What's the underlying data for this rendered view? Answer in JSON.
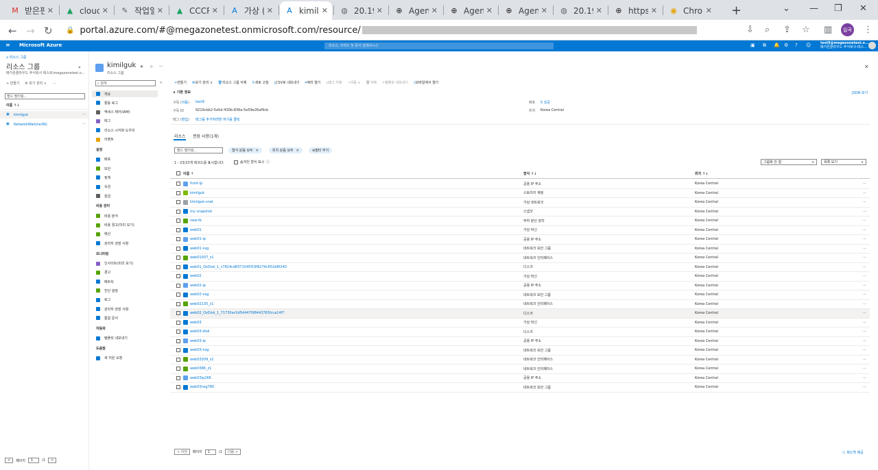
{
  "browser": {
    "tabs": [
      {
        "label": "받은편",
        "icon": "gmail-icon",
        "glyph": "M",
        "color": "#d93025"
      },
      {
        "label": "cloud",
        "icon": "drive-icon",
        "glyph": "▲",
        "color": "#1fa463"
      },
      {
        "label": "작업일",
        "icon": "edit-icon",
        "glyph": "✎",
        "color": "#5f6368"
      },
      {
        "label": "CCCR",
        "icon": "drive-icon",
        "glyph": "▲",
        "color": "#1fa463"
      },
      {
        "label": "가상 (",
        "icon": "azure-icon",
        "glyph": "A",
        "color": "#0078d4"
      },
      {
        "label": "kimilg",
        "icon": "azure-icon",
        "glyph": "A",
        "color": "#0078d4",
        "active": true
      },
      {
        "label": "20.19(",
        "icon": "globe-icon",
        "glyph": "◍",
        "color": "#5f6368"
      },
      {
        "label": "Agenc",
        "icon": "globe-icon",
        "glyph": "⊕",
        "color": "#202124"
      },
      {
        "label": "Agenc",
        "icon": "globe-icon",
        "glyph": "⊕",
        "color": "#202124"
      },
      {
        "label": "Agenc",
        "icon": "globe-icon",
        "glyph": "⊕",
        "color": "#202124"
      },
      {
        "label": "20.19(",
        "icon": "globe-icon",
        "glyph": "◍",
        "color": "#5f6368"
      },
      {
        "label": "https:/",
        "icon": "globe-icon",
        "glyph": "⊕",
        "color": "#202124"
      },
      {
        "label": "Chron",
        "icon": "chrome-icon",
        "glyph": "◉",
        "color": "#e8a200"
      }
    ],
    "url": "portal.azure.com/#@megazonetest.onmicrosoft.com/resource/",
    "profile": "일곡"
  },
  "portal": {
    "brand": "Microsoft Azure",
    "search_placeholder": "리소스, 서비스 및 문서 검색(G+/)",
    "user_email": "test9@megazonetest.o...",
    "user_org": "메가존클라우드 주식회사-테스..."
  },
  "left": {
    "breadcrumb": "리소스 그룹",
    "title": "리소스 그룹",
    "subtitle": "메가존클라우드 주식회사 테스트(megazonetest.o...",
    "create": "+ 만들기",
    "manage_view": "보기 관리 ∨",
    "more": "···",
    "filter_placeholder": "필드 필터링...",
    "col_name": "이름 ↑↓",
    "items": [
      "kimilguk",
      "NetworkWatcherRG"
    ],
    "page_prev": "<",
    "page_label": "페이지",
    "page_value": "1",
    "page_of": "/1",
    "page_next": ">"
  },
  "resource": {
    "name": "kimilguk",
    "type": "리소스 그룹",
    "pin": "✭",
    "star": "☆",
    "more": "···"
  },
  "menu": {
    "search_placeholder": "검색",
    "collapse": "«",
    "top": [
      {
        "label": "개요",
        "icon": "overview-icon",
        "color": "#0078d4"
      },
      {
        "label": "활동 로그",
        "icon": "activity-log-icon",
        "color": "#0078d4"
      },
      {
        "label": "액세스 제어(IAM)",
        "icon": "iam-icon",
        "color": "#605e5c"
      },
      {
        "label": "태그",
        "icon": "tag-icon",
        "color": "#8661c5"
      },
      {
        "label": "리소스 시각화 도우미",
        "icon": "visualizer-icon",
        "color": "#0078d4"
      },
      {
        "label": "이벤트",
        "icon": "event-icon",
        "color": "#e8a200"
      }
    ],
    "sections": [
      {
        "title": "설정",
        "items": [
          {
            "label": "배포",
            "icon": "deploy-icon",
            "color": "#0078d4"
          },
          {
            "label": "보안",
            "icon": "security-icon",
            "color": "#57a300"
          },
          {
            "label": "정책",
            "icon": "policy-icon",
            "color": "#0078d4"
          },
          {
            "label": "속성",
            "icon": "properties-icon",
            "color": "#0078d4"
          },
          {
            "label": "잠금",
            "icon": "lock-icon",
            "color": "#605e5c"
          }
        ]
      },
      {
        "title": "비용 관리",
        "items": [
          {
            "label": "비용 분석",
            "icon": "cost-analysis-icon",
            "color": "#57a300"
          },
          {
            "label": "비용 경고(미리 보기)",
            "icon": "cost-alert-icon",
            "color": "#57a300"
          },
          {
            "label": "예산",
            "icon": "budget-icon",
            "color": "#57a300"
          },
          {
            "label": "관리자 권장 사항",
            "icon": "advisor-icon",
            "color": "#0078d4"
          }
        ]
      },
      {
        "title": "모니터링",
        "items": [
          {
            "label": "인사이트(미리 보기)",
            "icon": "insights-icon",
            "color": "#8661c5"
          },
          {
            "label": "경고",
            "icon": "alert-icon",
            "color": "#57a300"
          },
          {
            "label": "메트릭",
            "icon": "metrics-icon",
            "color": "#0078d4"
          },
          {
            "label": "진단 설정",
            "icon": "diagnostic-icon",
            "color": "#57a300"
          },
          {
            "label": "로그",
            "icon": "logs-icon",
            "color": "#0078d4"
          },
          {
            "label": "관리자 권장 사항",
            "icon": "advisor-icon",
            "color": "#0078d4"
          },
          {
            "label": "통합 문서",
            "icon": "workbook-icon",
            "color": "#0078d4"
          }
        ]
      },
      {
        "title": "자동화",
        "items": [
          {
            "label": "템플릿 내보내기",
            "icon": "export-template-icon",
            "color": "#0078d4"
          }
        ]
      },
      {
        "title": "도움말",
        "items": [
          {
            "label": "새 지원 요청",
            "icon": "support-icon",
            "color": "#0078d4"
          }
        ]
      }
    ]
  },
  "toolbar": [
    {
      "label": "만들기",
      "icon": "plus-icon"
    },
    {
      "label": "보기 관리 ∨",
      "icon": "gear-icon"
    },
    {
      "label": "리소스 그룹 삭제",
      "icon": "trash-icon"
    },
    {
      "label": "새로 고침",
      "icon": "refresh-icon"
    },
    {
      "label": "CSV로 내보내기",
      "icon": "download-icon"
    },
    {
      "label": "쿼리 열기",
      "icon": "query-icon"
    },
    {
      "label": "태그 지정",
      "icon": "tag-icon",
      "disabled": true
    },
    {
      "label": "이동 ∨",
      "icon": "move-icon",
      "disabled": true
    },
    {
      "label": "삭제",
      "icon": "trash-icon",
      "disabled": true
    },
    {
      "label": "템플릿 내보내기",
      "icon": "export-icon",
      "disabled": true
    },
    {
      "label": "모바일에서 열기",
      "icon": "mobile-icon"
    }
  ],
  "essentials": {
    "header": "기본 정보",
    "json_view": "JSON 보기",
    "subscription_label": "구독 (",
    "subscription_move": "이동",
    "subscription_close": ")",
    "subscription_value": "test9",
    "subscription_id_label": "구독 ID",
    "subscription_id_value": "9219cbb2-5a5d-430b-836a-5e59e26af9cb",
    "tags_label": "태그 (",
    "tags_edit": "편집",
    "tags_close": ")",
    "tags_value": "태그를 추가하려면 여기를 클릭",
    "deployments_label": "배포",
    "deployments_value": "5 성공",
    "location_label": "위치",
    "location_value": "Korea Central"
  },
  "tabs": {
    "resources": "리소스",
    "recommendations": "권장 사항(1개)"
  },
  "filters": {
    "placeholder": "필드 필터링...",
    "type_pill": "형식 같음 모두",
    "loc_pill": "위치 같음 모두",
    "add_filter": "필터 추가",
    "count_text": "1 - 23/23개 레코드를 표시합니다.",
    "show_hidden": "숨겨진 형식 표시",
    "group_by": "그룹화 안 함",
    "view": "목록 보기"
  },
  "table": {
    "col_name": "이름 ↑",
    "col_type": "형식 ↑↓",
    "col_location": "위치 ↑↓",
    "rows": [
      {
        "name": "front-ip",
        "type": "공용 IP 주소",
        "location": "Korea Central",
        "icon": "public-ip-icon",
        "color": "#5ea0ef"
      },
      {
        "name": "kimilguk",
        "type": "스토리지 계정",
        "location": "Korea Central",
        "icon": "storage-icon",
        "color": "#7fba00"
      },
      {
        "name": "kimilguk-vnet",
        "type": "가상 네트워크",
        "location": "Korea Central",
        "icon": "vnet-icon",
        "color": "#9aa0a6"
      },
      {
        "name": "my snapshot",
        "type": "스냅샷",
        "location": "Korea Central",
        "icon": "snapshot-icon",
        "color": "#0078d4"
      },
      {
        "name": "new-lb",
        "type": "부하 분산 장치",
        "location": "Korea Central",
        "icon": "lb-icon",
        "color": "#57a300"
      },
      {
        "name": "web01",
        "type": "가상 머신",
        "location": "Korea Central",
        "icon": "vm-icon",
        "color": "#0078d4"
      },
      {
        "name": "web01-ip",
        "type": "공용 IP 주소",
        "location": "Korea Central",
        "icon": "public-ip-icon",
        "color": "#5ea0ef"
      },
      {
        "name": "web01-nsg",
        "type": "네트워크 보안 그룹",
        "location": "Korea Central",
        "icon": "nsg-icon",
        "color": "#0078d4"
      },
      {
        "name": "web01937_z1",
        "type": "네트워크 인터페이스",
        "location": "Korea Central",
        "icon": "nic-icon",
        "color": "#57a300"
      },
      {
        "name": "web01_OsDisk_1_c7824cd8371545f19f6274c652b8f240",
        "type": "디스크",
        "location": "Korea Central",
        "icon": "disk-icon",
        "color": "#0078d4"
      },
      {
        "name": "web02",
        "type": "가상 머신",
        "location": "Korea Central",
        "icon": "vm-icon",
        "color": "#0078d4"
      },
      {
        "name": "web02-ip",
        "type": "공용 IP 주소",
        "location": "Korea Central",
        "icon": "public-ip-icon",
        "color": "#5ea0ef"
      },
      {
        "name": "web02-nsg",
        "type": "네트워크 보안 그룹",
        "location": "Korea Central",
        "icon": "nsg-icon",
        "color": "#0078d4"
      },
      {
        "name": "web02135_z1",
        "type": "네트워크 인터페이스",
        "location": "Korea Central",
        "icon": "nic-icon",
        "color": "#57a300"
      },
      {
        "name": "web02_OsDisk_1_71730ec0d54447f98443783fcca14f7",
        "type": "디스크",
        "location": "Korea Central",
        "icon": "disk-icon",
        "color": "#0078d4",
        "highlight": true
      },
      {
        "name": "web03",
        "type": "가상 머신",
        "location": "Korea Central",
        "icon": "vm-icon",
        "color": "#0078d4"
      },
      {
        "name": "web03-disk",
        "type": "디스크",
        "location": "Korea Central",
        "icon": "disk-icon",
        "color": "#0078d4"
      },
      {
        "name": "web03-ip",
        "type": "공용 IP 주소",
        "location": "Korea Central",
        "icon": "public-ip-icon",
        "color": "#5ea0ef"
      },
      {
        "name": "web03-nsg",
        "type": "네트워크 보안 그룹",
        "location": "Korea Central",
        "icon": "nsg-icon",
        "color": "#0078d4"
      },
      {
        "name": "web03209_z1",
        "type": "네트워크 인터페이스",
        "location": "Korea Central",
        "icon": "nic-icon",
        "color": "#57a300"
      },
      {
        "name": "web0386_z1",
        "type": "네트워크 인터페이스",
        "location": "Korea Central",
        "icon": "nic-icon",
        "color": "#57a300"
      },
      {
        "name": "web03ip266",
        "type": "공용 IP 주소",
        "location": "Korea Central",
        "icon": "public-ip-icon",
        "color": "#5ea0ef"
      },
      {
        "name": "web03nsg780",
        "type": "네트워크 보안 그룹",
        "location": "Korea Central",
        "icon": "nsg-icon",
        "color": "#0078d4"
      }
    ]
  },
  "pager": {
    "prev": "< 이전",
    "page": "페이지",
    "value": "1",
    "of": "/1",
    "next": "다음 >"
  },
  "feedback": "피드백 제공",
  "row_more": "···"
}
